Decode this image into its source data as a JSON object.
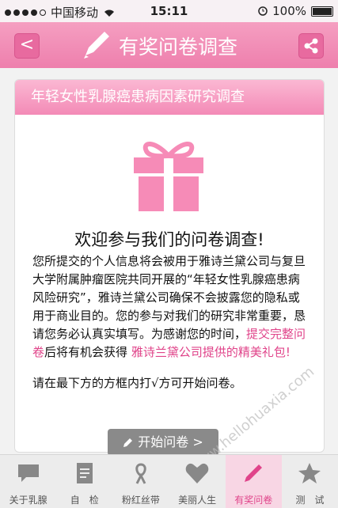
{
  "status": {
    "carrier": "中国移动",
    "time": "15:11",
    "battery": "100%"
  },
  "header": {
    "title": "有奖问卷调查",
    "back_label": "<"
  },
  "card": {
    "banner": "年轻女性乳腺癌患病因素研究调查",
    "welcome": "欢迎参与我们的问卷调查!",
    "para_a": "您所提交的个人信息将会被用于雅诗兰黛公司与复旦大学附属肿瘤医院共同开展的“年轻女性乳腺癌患病风险研究”，雅诗兰黛公司确保不会披露您的隐私或用于商业目的。您的参与对我们的研究非常重要，恳请您务必认真实填写。为感谢您的时间，",
    "para_hl1": "提交完整问卷",
    "para_b": "后将有机会获得",
    "para_hl2": "雅诗兰黛公司提供的精美礼包!",
    "para2": "请在最下方的方框内打√方可开始问卷。"
  },
  "start_button": "开始问卷 >",
  "tabs": [
    {
      "label": "关于乳腺"
    },
    {
      "label": "自　检"
    },
    {
      "label": "粉红丝带"
    },
    {
      "label": "美丽人生"
    },
    {
      "label": "有奖问卷"
    },
    {
      "label": "测　试"
    }
  ],
  "watermark": "www.hellohuaxia.com"
}
